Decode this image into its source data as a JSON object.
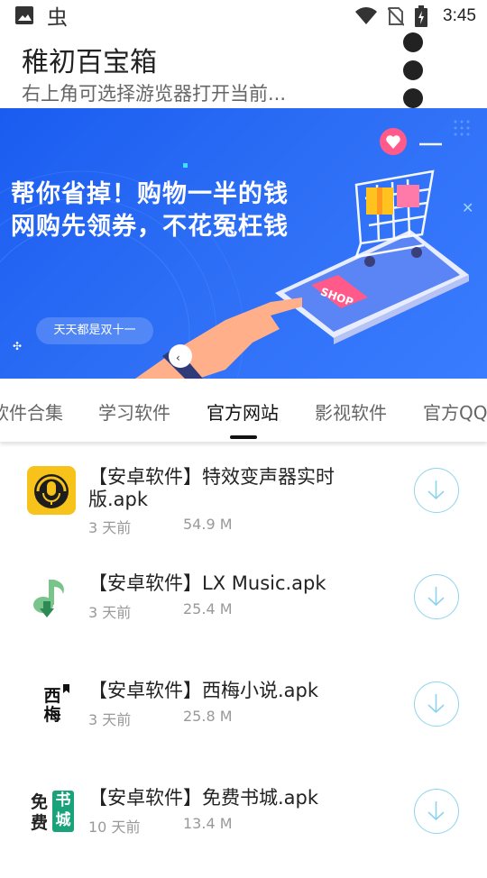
{
  "status_bar": {
    "time": "3:45",
    "left_icons": [
      "image-icon",
      "bug-icon"
    ],
    "right_icons": [
      "wifi-icon",
      "no-sim-icon",
      "battery-charging-icon"
    ]
  },
  "header": {
    "title": "稚初百宝箱",
    "subtitle": "右上角可选择游览器打开当前..."
  },
  "banner": {
    "headline_line1": "帮你省掉！购物一半的钱",
    "headline_line2": "网购先领券，不花冤枉钱",
    "pill_text": "天天都是双十一",
    "shop_tag": "SHOP"
  },
  "tabs": [
    {
      "label": "软件合集"
    },
    {
      "label": "学习软件"
    },
    {
      "label": "官方网站"
    },
    {
      "label": "影视软件"
    },
    {
      "label": "官方QQ"
    }
  ],
  "active_tab": "官方网站",
  "downloads": [
    {
      "name": "【安卓软件】特效变声器实时版.apk",
      "time": "3 天前",
      "size": "54.9 M",
      "icon": "voice-changer-icon"
    },
    {
      "name": "【安卓软件】LX Music.apk",
      "time": "3 天前",
      "size": "25.4 M",
      "icon": "lx-music-icon"
    },
    {
      "name": "【安卓软件】西梅小说.apk",
      "time": "3 天前",
      "size": "25.8 M",
      "icon": "ximei-novel-icon",
      "icon_text": "西梅"
    },
    {
      "name": "【安卓软件】免费书城.apk",
      "time": "10 天前",
      "size": "13.4 M",
      "icon": "free-bookstore-icon",
      "icon_text_a": "免费",
      "icon_text_b": "书城"
    }
  ],
  "colors": {
    "banner_blue": "#2c6df5",
    "download_ring": "#8fd4ee",
    "voice_icon_yellow": "#f7c31a",
    "lx_icon_green": "#4cbf7f",
    "bookstore_green": "#1aa37a"
  }
}
